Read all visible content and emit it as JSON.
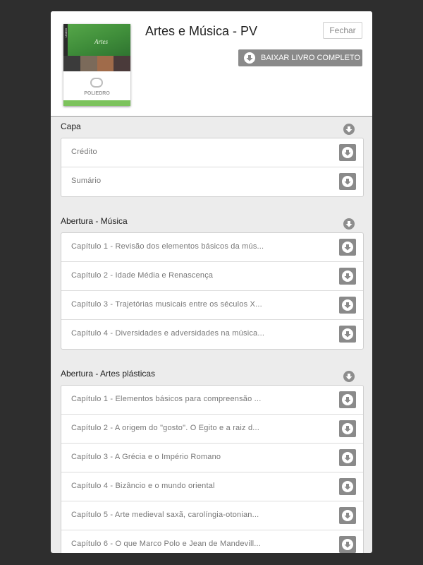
{
  "book": {
    "title": "Artes e Música - PV",
    "close_label": "Fechar",
    "download_all_label": "BAIXAR LIVRO COMPLETO",
    "cover": {
      "series": "UNICO",
      "title": "Artes",
      "brand": "POLIEDRO"
    }
  },
  "sections": [
    {
      "title": "Capa",
      "items": [
        "Crédito",
        "Sumário"
      ]
    },
    {
      "title": "Abertura - Música",
      "items": [
        "Capítulo 1 - Revisão dos elementos básicos da mús...",
        "Capítulo 2 - Idade Média e Renascença",
        "Capítulo 3 - Trajetórias musicais entre os séculos X...",
        "Capítulo 4 - Diversidades e adversidades na música..."
      ]
    },
    {
      "title": "Abertura - Artes plásticas",
      "items": [
        "Capítulo 1 - Elementos básicos para compreensão ...",
        "Capítulo 2 - A origem do \"gosto\". O Egito e a raiz d...",
        "Capítulo 3 - A Grécia e o Império Romano",
        "Capítulo 4 - Bizâncio e o mundo oriental",
        "Capítulo 5 - Arte medieval saxã, carolíngia-otonian...",
        "Capítulo 6 - O que Marco Polo e Jean de Mandevill..."
      ]
    }
  ],
  "colors": {
    "backdrop": "#2e2e2e",
    "panel": "#ececec",
    "button_gray": "#8a8a8a",
    "cover_green": "#3f8d3a"
  }
}
